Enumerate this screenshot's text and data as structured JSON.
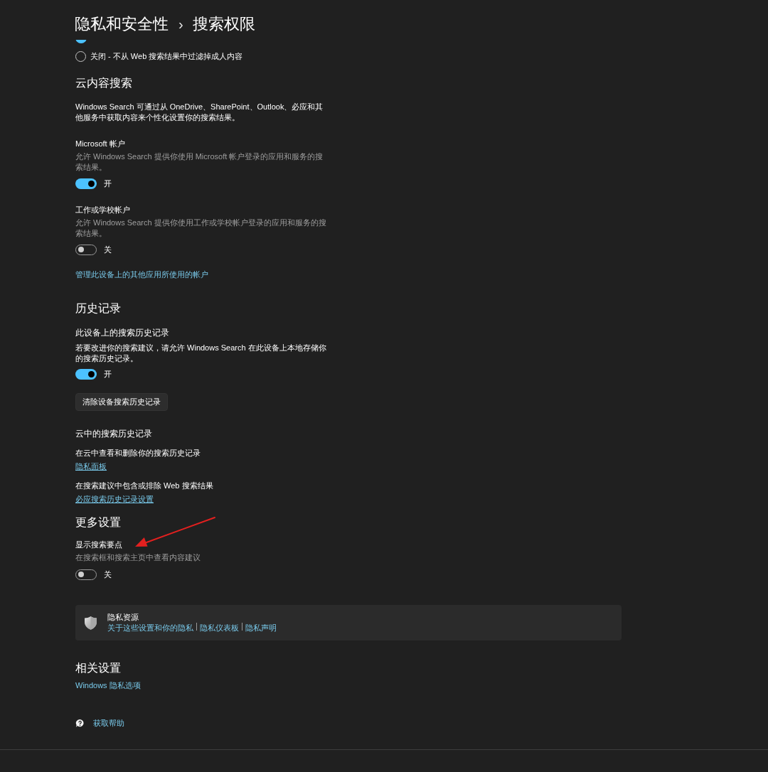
{
  "header": {
    "breadcrumb_parent": "隐私和安全性",
    "separator": "›",
    "title": "搜索权限"
  },
  "safe_search": {
    "options": [
      {
        "selected": true
      },
      {
        "label": "关闭 - 不从 Web 搜索结果中过滤掉成人内容",
        "selected": false
      }
    ]
  },
  "cloud_content_search": {
    "heading": "云内容搜索",
    "description": "Windows Search 可通过从 OneDrive、SharePoint、Outlook、必应和其他服务中获取内容来个性化设置你的搜索结果。",
    "settings": [
      {
        "title": "Microsoft 帐户",
        "description": "允许 Windows Search 提供你使用 Microsoft 帐户登录的应用和服务的搜索结果。",
        "on": true,
        "state_label": "开"
      },
      {
        "title": "工作或学校帐户",
        "description": "允许 Windows Search 提供你使用工作或学校帐户登录的应用和服务的搜索结果。",
        "on": false,
        "state_label": "关"
      }
    ],
    "link": "管理此设备上的其他应用所使用的帐户"
  },
  "history": {
    "heading": "历史记录",
    "device": {
      "title": "此设备上的搜索历史记录",
      "description": "若要改进你的搜索建议，请允许 Windows Search 在此设备上本地存储你的搜索历史记录。",
      "on": true,
      "state_label": "开",
      "button": "清除设备搜索历史记录"
    },
    "cloud": {
      "title": "云中的搜索历史记录",
      "items": [
        {
          "text": "在云中查看和删除你的搜索历史记录",
          "link": "隐私面板"
        },
        {
          "text": "在搜索建议中包含或排除 Web 搜索结果",
          "link": "必应搜索历史记录设置"
        }
      ]
    }
  },
  "more_settings": {
    "heading": "更多设置",
    "settings": [
      {
        "title": "显示搜索要点",
        "description": "在搜索框和搜索主页中查看内容建议",
        "on": false,
        "state_label": "关"
      }
    ]
  },
  "privacy_resources": {
    "title": "隐私资源",
    "links": [
      "关于这些设置和你的隐私",
      "隐私仪表板",
      "隐私声明"
    ]
  },
  "related_settings": {
    "heading": "相关设置",
    "links": [
      "Windows 隐私选项"
    ]
  },
  "help": {
    "label": "获取帮助"
  }
}
